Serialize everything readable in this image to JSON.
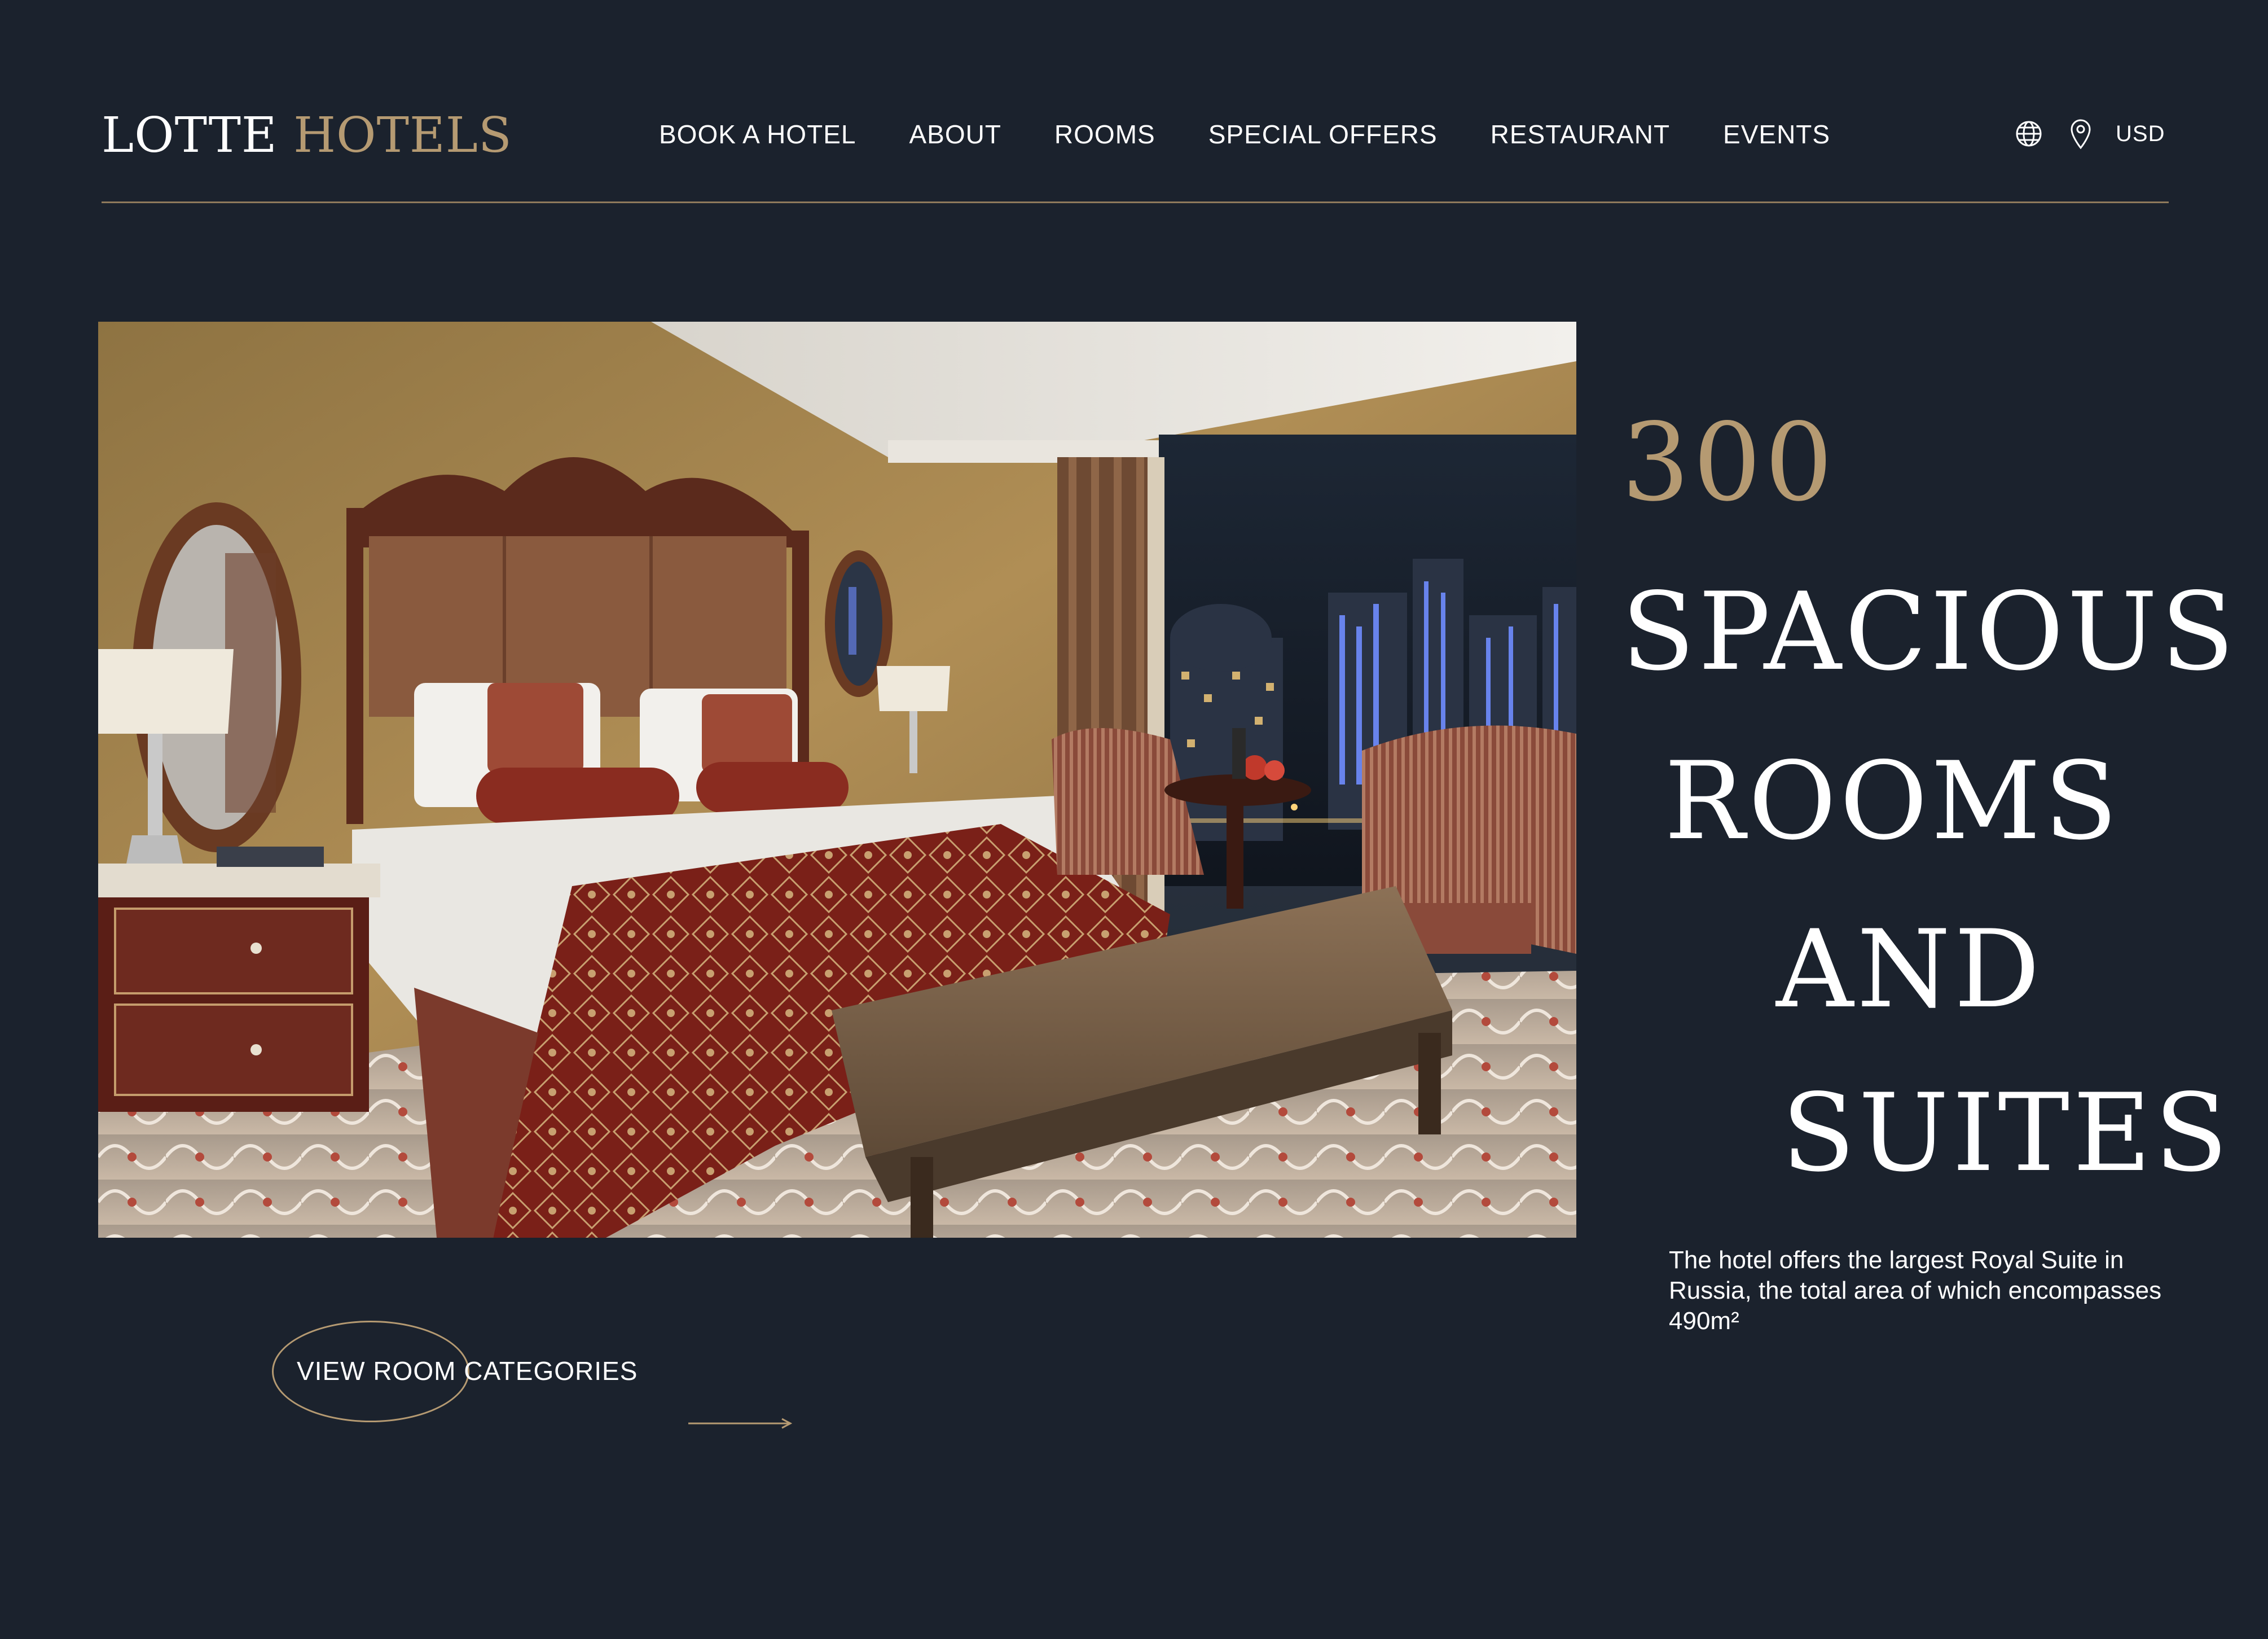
{
  "brand": {
    "name_part1": "LOTTE",
    "name_part2": "HOTELS"
  },
  "nav": {
    "items": [
      {
        "label": "BOOK A HOTEL"
      },
      {
        "label": "ABOUT"
      },
      {
        "label": "ROOMS"
      },
      {
        "label": "SPECIAL OFFERS"
      },
      {
        "label": "RESTAURANT"
      },
      {
        "label": "EVENTS"
      }
    ]
  },
  "header_tools": {
    "currency": "USD",
    "language_icon": "globe-icon",
    "location_icon": "map-pin-icon"
  },
  "hero": {
    "number": "300",
    "title_lines": [
      "SPACIOUS",
      "ROOMS",
      "AND",
      "SUITES"
    ],
    "description": "The hotel offers the largest Royal Suite in Russia, the total area of which encompasses 490m²",
    "cta_label": "VIEW ROOM CATEGORIES",
    "cta_icon": "arrow-right-icon"
  },
  "colors": {
    "background": "#1b222d",
    "accent": "#b59a72",
    "text": "#ffffff"
  }
}
